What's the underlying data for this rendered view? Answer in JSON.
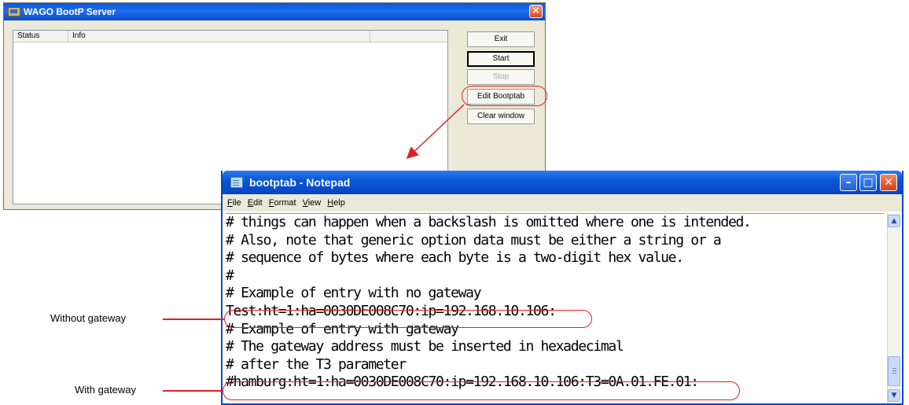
{
  "bootp_window": {
    "title": "WAGO BootP Server",
    "close_glyph": "✕",
    "list": {
      "columns": [
        "Status",
        "Info"
      ]
    },
    "buttons": {
      "exit": "Exit",
      "start": "Start",
      "stop": "Stop",
      "edit_bootptab": "Edit Bootptab",
      "clear_window": "Clear window"
    }
  },
  "notepad_window": {
    "title": "bootptab - Notepad",
    "controls": {
      "minimize": "–",
      "maximize": "□",
      "close": "✕"
    },
    "menu": [
      "File",
      "Edit",
      "Format",
      "View",
      "Help"
    ],
    "lines": [
      "# things can happen when a backslash is omitted where one is intended.",
      "# Also, note that generic option data must be either a string or a",
      "# sequence of bytes where each byte is a two-digit hex value.",
      "#",
      "# Example of entry with no gateway",
      "Test:ht=1:ha=0030DE008C70:ip=192.168.10.106:",
      "# Example of entry with gateway",
      "# The gateway address must be inserted in hexadecimal",
      "# after the T3 parameter",
      "#hamburg:ht=1:ha=0030DE008C70:ip=192.168.10.106:T3=0A.01.FE.01:"
    ],
    "scrollbar": {
      "up_glyph": "▲",
      "down_glyph": "▼"
    }
  },
  "annotations": {
    "without_gateway": "Without gateway",
    "with_gateway": "With gateway"
  },
  "colors": {
    "annotation_red": "#e02020",
    "xp_title_blue": "#0b57d6",
    "dialog_face": "#ece9d8"
  },
  "icons": {
    "bootp_app": "wago-app-icon",
    "notepad_app": "notepad-icon"
  }
}
